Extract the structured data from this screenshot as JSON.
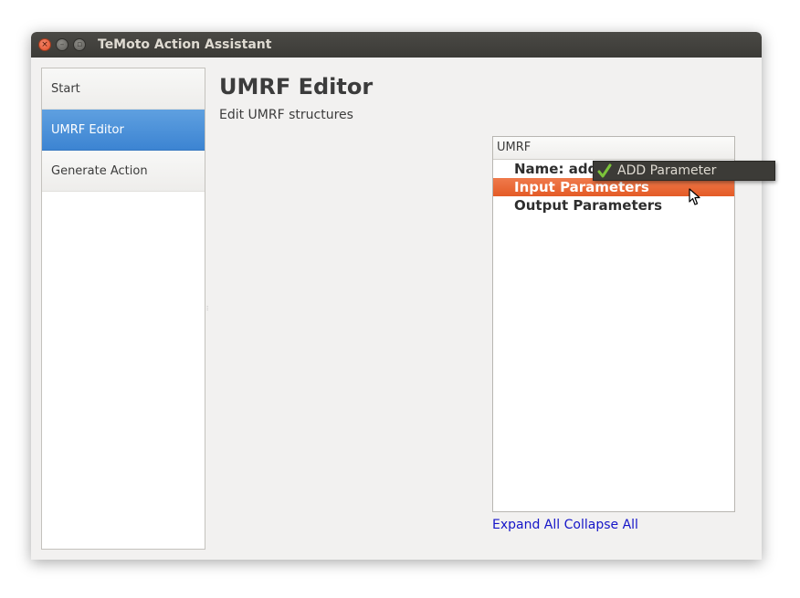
{
  "window": {
    "title": "TeMoto Action Assistant",
    "close_glyph": "×",
    "min_glyph": "–",
    "max_glyph": "▫"
  },
  "sidebar": {
    "items": [
      {
        "label": "Start",
        "active": false
      },
      {
        "label": "UMRF Editor",
        "active": true
      },
      {
        "label": "Generate Action",
        "active": false
      }
    ]
  },
  "main": {
    "title": "UMRF Editor",
    "subtitle": "Edit UMRF structures"
  },
  "tree": {
    "header": "UMRF",
    "rows": [
      {
        "label": "Name: add",
        "selected": false
      },
      {
        "label": "Input Parameters",
        "selected": true
      },
      {
        "label": "Output Parameters",
        "selected": false
      }
    ]
  },
  "links": {
    "expand_all": "Expand All",
    "collapse_all": "Collapse All"
  },
  "context_menu": {
    "items": [
      {
        "label": "ADD Parameter",
        "icon": "checkmark-icon"
      }
    ]
  },
  "colors": {
    "accent_blue": "#3c84d2",
    "selection_orange": "#e45b26",
    "link_blue": "#1515c8",
    "titlebar": "#3c3b37",
    "check_green": "#7cc33a"
  }
}
